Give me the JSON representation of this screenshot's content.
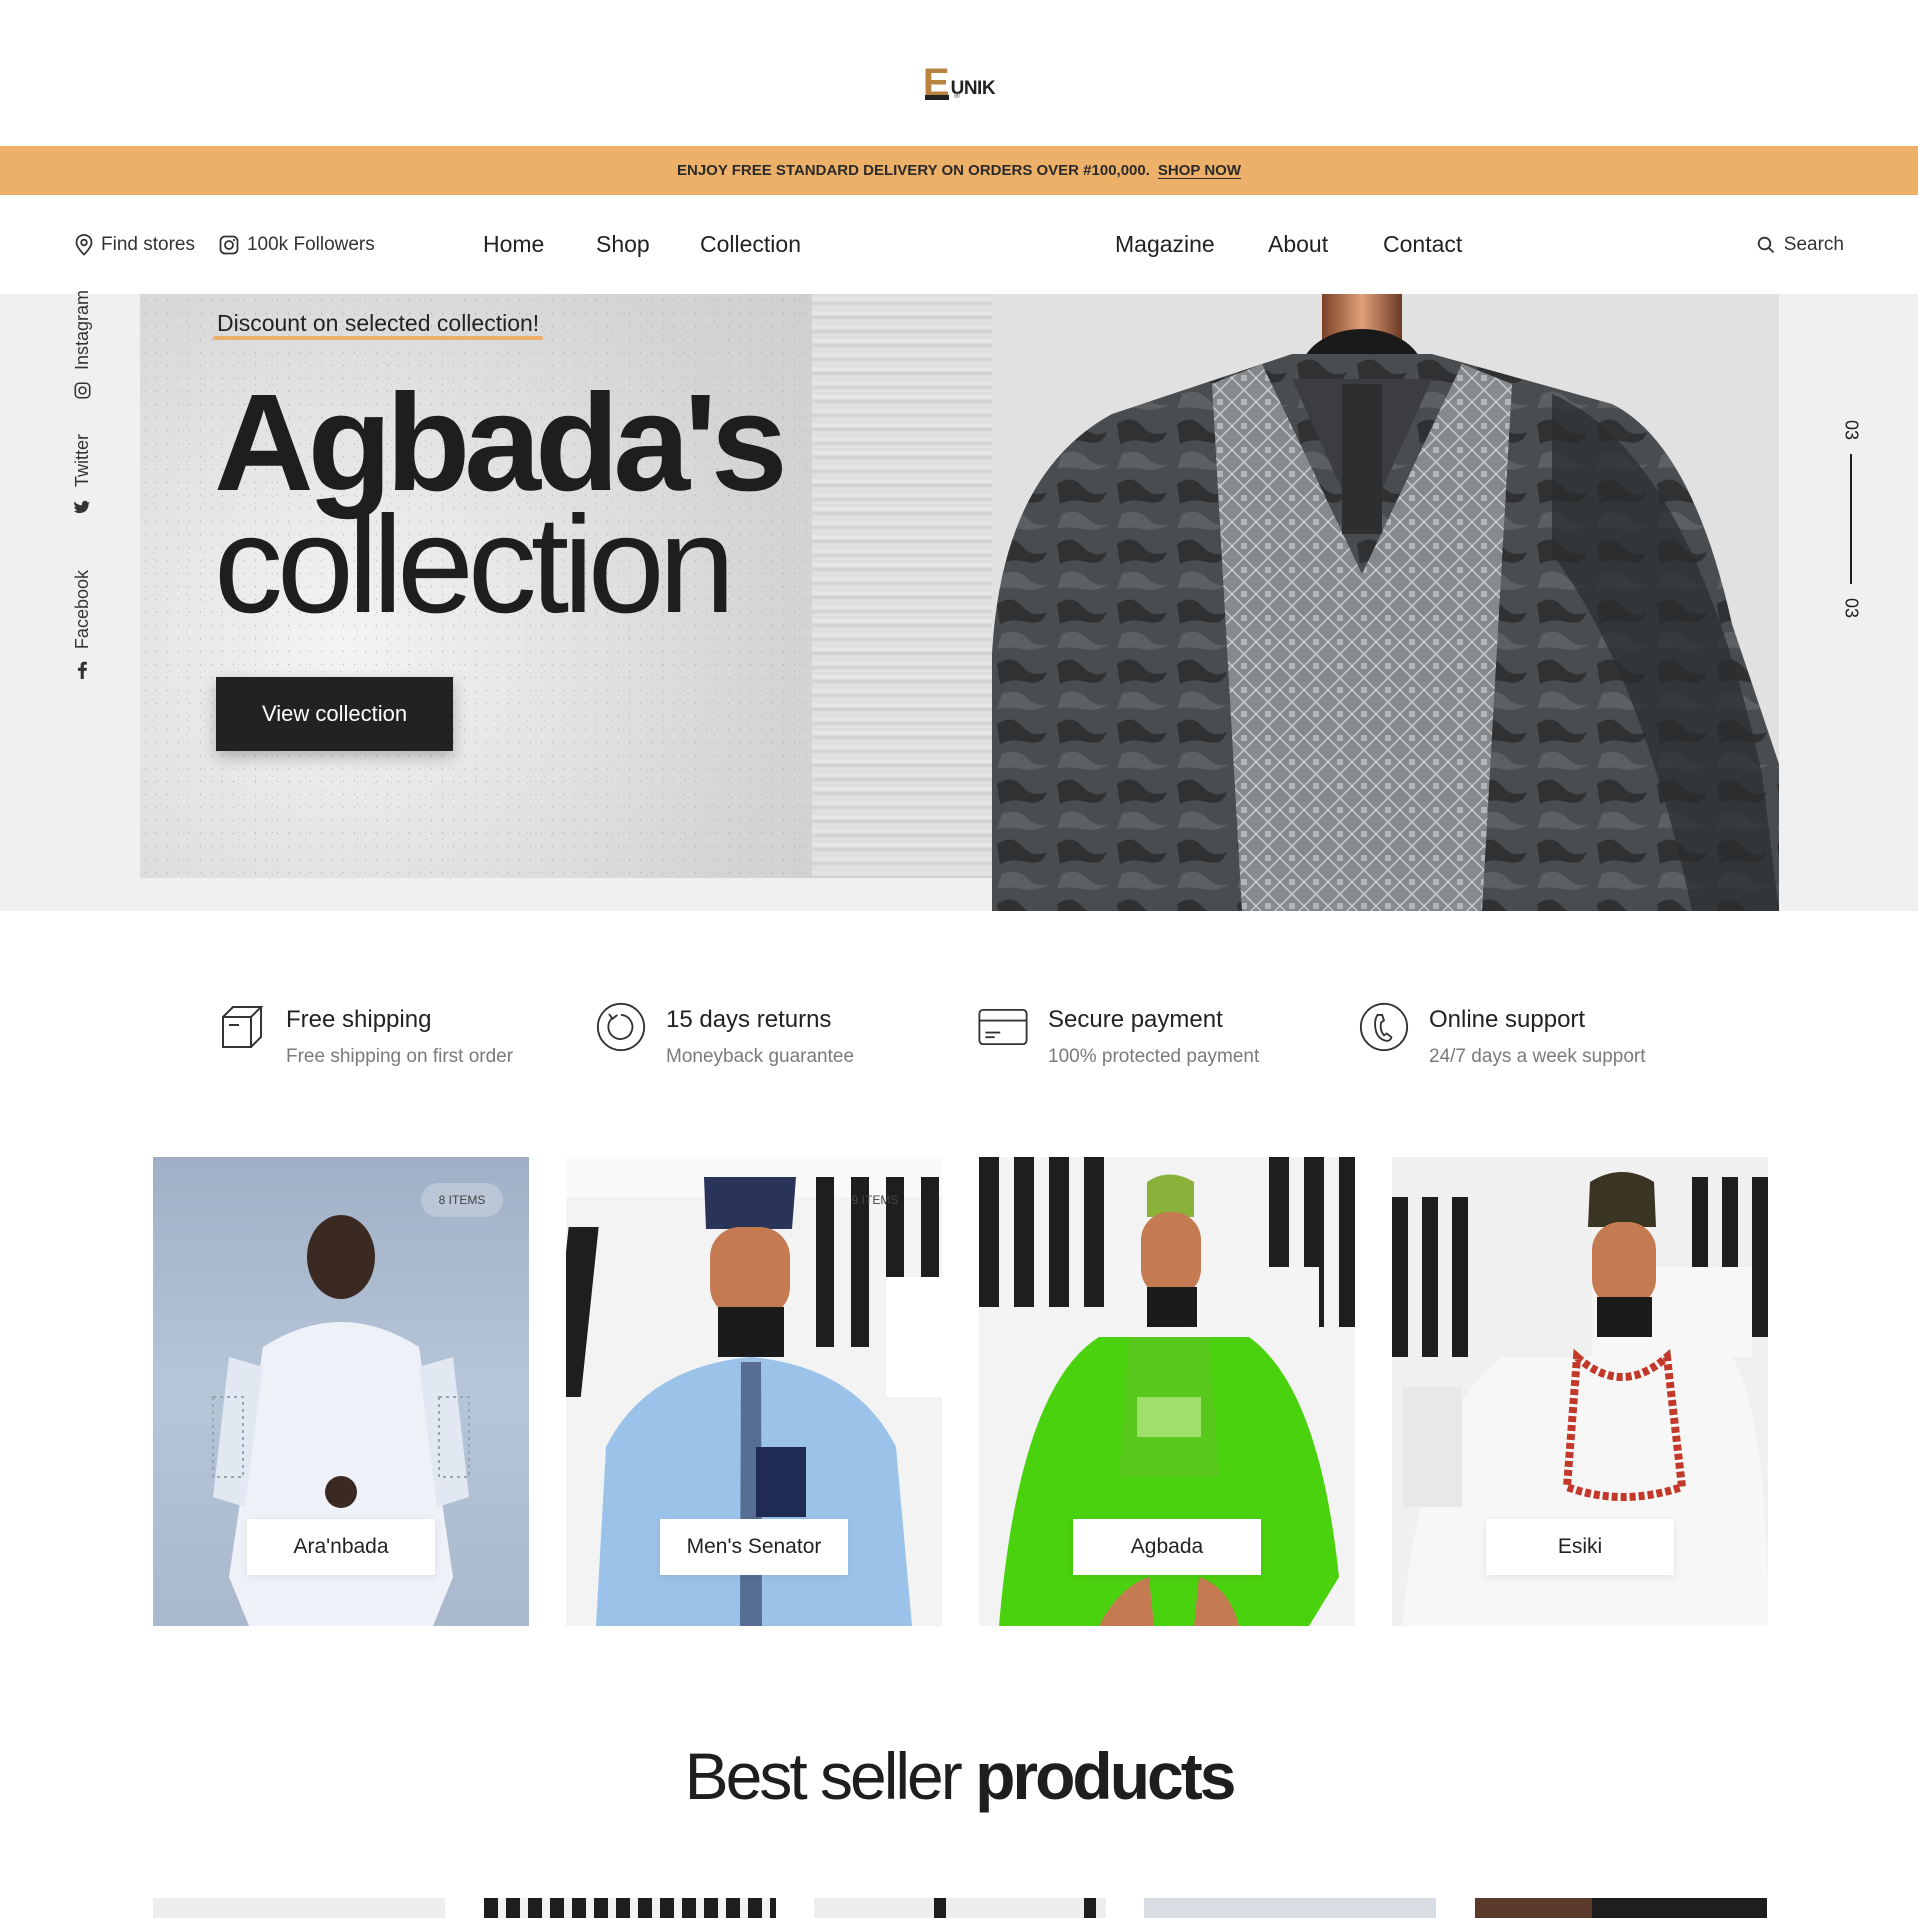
{
  "brand": {
    "logo_letter": "E",
    "logo_text": "UNIK",
    "logo_mark": "®"
  },
  "promo": {
    "text": "ENJOY FREE STANDARD DELIVERY ON ORDERS OVER #100,000.",
    "link": "SHOP NOW"
  },
  "nav": {
    "find_stores": "Find stores",
    "followers": "100k Followers",
    "menu": [
      "Home",
      "Shop",
      "Collection",
      "Magazine",
      "About",
      "Contact"
    ],
    "search": "Search"
  },
  "hero": {
    "tag": "Discount on selected collection!",
    "title_line1": "Agbada's",
    "title_line2": "collection",
    "button": "View collection",
    "slide_current": "03",
    "slide_total": "03"
  },
  "social": [
    "Instagram",
    "Twitter",
    "Facebook"
  ],
  "features": [
    {
      "title": "Free shipping",
      "desc": "Free shipping on first order",
      "icon": "box-icon"
    },
    {
      "title": "15 days returns",
      "desc": "Moneyback guarantee",
      "icon": "return-icon"
    },
    {
      "title": "Secure payment",
      "desc": "100% protected payment",
      "icon": "card-icon"
    },
    {
      "title": "Online support",
      "desc": "24/7 days a week support",
      "icon": "support-icon"
    }
  ],
  "categories": [
    {
      "label": "Ara'nbada",
      "count": "8 ITEMS"
    },
    {
      "label": "Men's Senator",
      "count": "9 ITEMS"
    },
    {
      "label": "Agbada",
      "count": ""
    },
    {
      "label": "Esiki",
      "count": ""
    }
  ],
  "best_seller": {
    "prefix": "Best seller",
    "highlight": "products"
  },
  "colors": {
    "accent": "#edb068",
    "dark": "#222222",
    "muted": "#7a7a7a"
  }
}
